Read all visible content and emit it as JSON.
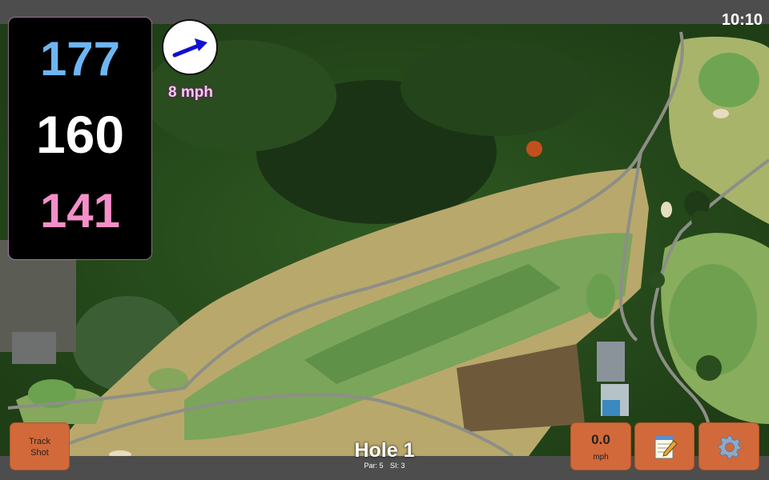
{
  "status_bar": {
    "time": "10:10"
  },
  "distances": {
    "back": "177",
    "middle": "160",
    "front": "141"
  },
  "wind": {
    "speed_text": "8 mph",
    "direction": "northeast"
  },
  "hole": {
    "title": "Hole 1",
    "par": "Par: 5",
    "stroke_index": "SI: 3"
  },
  "buttons": {
    "track_shot_line1": "Track",
    "track_shot_line2": "Shot",
    "wind_value": "0.0",
    "wind_unit": "mph",
    "notes_icon": "notepad-icon",
    "settings_icon": "gear-icon"
  },
  "colors": {
    "back_distance": "#6db6f3",
    "middle_distance": "#ffffff",
    "front_distance": "#f58fc8",
    "button": "#d2693a",
    "wind_arrow": "#1010d0"
  }
}
